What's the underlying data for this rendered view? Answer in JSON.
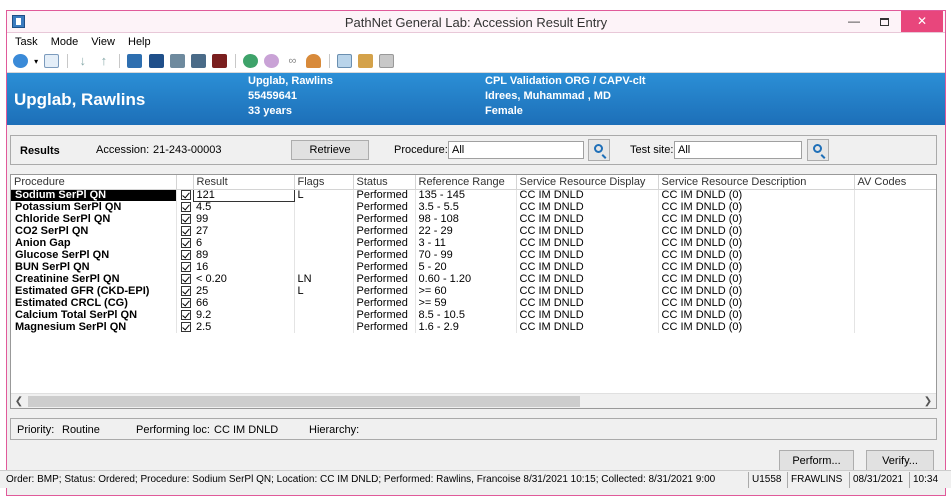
{
  "window": {
    "title": "PathNet General Lab: Accession Result Entry"
  },
  "menu": [
    "Task",
    "Mode",
    "View",
    "Help"
  ],
  "toolbar_icons": [
    "navigate-icon",
    "dropdown-icon",
    "document-icon",
    "arrow-down-icon",
    "arrow-up-icon",
    "patient-icon",
    "list-icon",
    "panel-icon",
    "table-icon",
    "stop-icon",
    "globe-icon",
    "flask-icon",
    "glasses-icon",
    "person-icon",
    "chart-icon",
    "print-icon",
    "grid-icon"
  ],
  "patient": {
    "name": "Upglab, Rawlins",
    "line1": "Upglab, Rawlins",
    "line2": "55459641",
    "line3": "33 years",
    "org": "CPL Validation ORG / CAPV-clt",
    "physician": "Idrees, Muhammad , MD",
    "sex": "Female"
  },
  "filter": {
    "results_label": "Results",
    "accession_label": "Accession:",
    "accession_value": "21-243-00003",
    "retrieve_label": "Retrieve",
    "procedure_label": "Procedure:",
    "procedure_value": "All",
    "test_site_label": "Test site:",
    "test_site_value": "All"
  },
  "table": {
    "columns": [
      "Procedure",
      "Result",
      "Flags",
      "Status",
      "Reference Range",
      "Service Resource Display",
      "Service Resource Description",
      "AV Codes"
    ],
    "rows": [
      {
        "procedure": "Sodium SerPl QN",
        "result": "121",
        "flags": "L",
        "status": "Performed",
        "range": "135 - 145",
        "display": "CC IM DNLD",
        "description": "CC IM DNLD (0)"
      },
      {
        "procedure": "Potassium SerPl QN",
        "result": "4.5",
        "flags": "",
        "status": "Performed",
        "range": "3.5 - 5.5",
        "display": "CC IM DNLD",
        "description": "CC IM DNLD (0)"
      },
      {
        "procedure": "Chloride SerPl QN",
        "result": "99",
        "flags": "",
        "status": "Performed",
        "range": "98 - 108",
        "display": "CC IM DNLD",
        "description": "CC IM DNLD (0)"
      },
      {
        "procedure": "CO2 SerPl QN",
        "result": "27",
        "flags": "",
        "status": "Performed",
        "range": "22 - 29",
        "display": "CC IM DNLD",
        "description": "CC IM DNLD (0)"
      },
      {
        "procedure": "Anion Gap",
        "result": "6",
        "flags": "",
        "status": "Performed",
        "range": "3 - 11",
        "display": "CC IM DNLD",
        "description": "CC IM DNLD (0)"
      },
      {
        "procedure": "Glucose SerPl QN",
        "result": "89",
        "flags": "",
        "status": "Performed",
        "range": "70 - 99",
        "display": "CC IM DNLD",
        "description": "CC IM DNLD (0)"
      },
      {
        "procedure": "BUN SerPl QN",
        "result": "16",
        "flags": "",
        "status": "Performed",
        "range": "5 - 20",
        "display": "CC IM DNLD",
        "description": "CC IM DNLD (0)"
      },
      {
        "procedure": "Creatinine SerPl QN",
        "result": "< 0.20",
        "flags": "LN",
        "status": "Performed",
        "range": "0.60 - 1.20",
        "display": "CC IM DNLD",
        "description": "CC IM DNLD (0)"
      },
      {
        "procedure": "Estimated GFR (CKD-EPI)",
        "result": "25",
        "flags": "L",
        "status": "Performed",
        "range": ">= 60",
        "display": "CC IM DNLD",
        "description": "CC IM DNLD (0)"
      },
      {
        "procedure": "Estimated CRCL (CG)",
        "result": "66",
        "flags": "",
        "status": "Performed",
        "range": ">= 59",
        "display": "CC IM DNLD",
        "description": "CC IM DNLD (0)"
      },
      {
        "procedure": "Calcium Total SerPl QN",
        "result": "9.2",
        "flags": "",
        "status": "Performed",
        "range": "8.5 - 10.5",
        "display": "CC IM DNLD",
        "description": "CC IM DNLD (0)"
      },
      {
        "procedure": "Magnesium SerPl QN",
        "result": "2.5",
        "flags": "",
        "status": "Performed",
        "range": "1.6 - 2.9",
        "display": "CC IM DNLD",
        "description": "CC IM DNLD (0)"
      }
    ]
  },
  "details": {
    "priority_label": "Priority:",
    "priority_value": "Routine",
    "loc_label": "Performing loc:",
    "loc_value": "CC IM DNLD",
    "hierarchy_label": "Hierarchy:"
  },
  "actions": {
    "perform": "Perform...",
    "verify": "Verify..."
  },
  "status_bar": {
    "message": "Order: BMP; Status: Ordered; Procedure: Sodium SerPl QN; Location: CC IM DNLD; Performed: Rawlins, Francoise 8/31/2021 10:15; Collected: 8/31/2021 9:00",
    "code": "U1558",
    "user": "FRAWLINS",
    "date": "08/31/2021",
    "time": "10:34"
  },
  "colors": {
    "banner": "#1d6fb8",
    "close_button": "#e8467c",
    "window_border": "#e05a9a"
  }
}
